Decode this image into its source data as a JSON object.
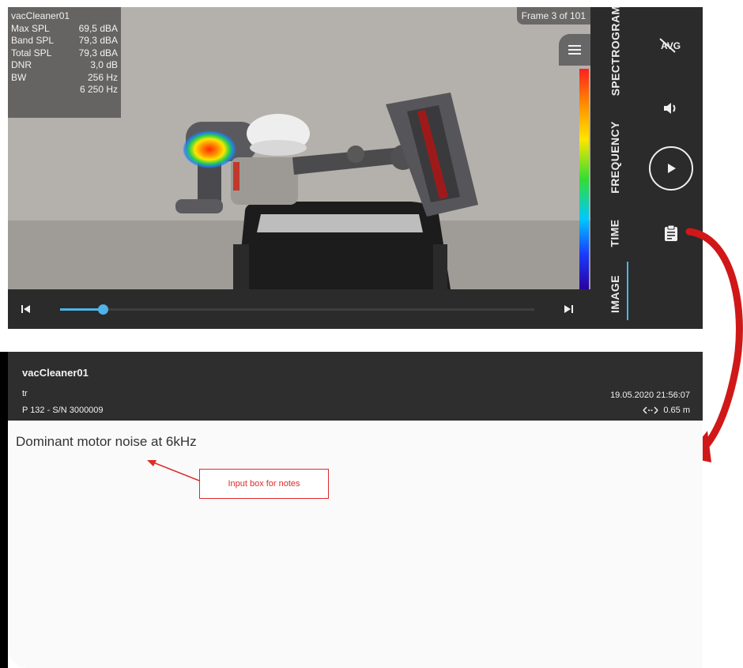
{
  "recording": {
    "name": "vacCleaner01",
    "frame_label": "Frame 3 of 101",
    "stats": [
      {
        "label": "Max SPL",
        "value": "69,5 dBA"
      },
      {
        "label": "Band SPL",
        "value": "79,3 dBA"
      },
      {
        "label": "Total SPL",
        "value": "79,3 dBA"
      },
      {
        "label": "DNR",
        "value": "3,0 dB"
      },
      {
        "label": "BW",
        "value": "256 Hz"
      },
      {
        "label": "",
        "value": "6 250 Hz"
      }
    ],
    "playback_progress": 0.09
  },
  "tabs": [
    {
      "label": "SPECTROGRAM"
    },
    {
      "label": "FREQUENCY"
    },
    {
      "label": "TIME"
    },
    {
      "label": "IMAGE",
      "active": true
    }
  ],
  "actions": {
    "avg_label": "AVG",
    "icons": [
      "avg-off-icon",
      "volume-icon",
      "play-icon",
      "clipboard-icon"
    ]
  },
  "details": {
    "title": "vacCleaner01",
    "user": "tr",
    "device": "P 132 - S/N 3000009",
    "datetime": "19.05.2020 21:56:07",
    "distance": "0.65 m",
    "notes": "Dominant motor noise at 6kHz"
  },
  "annotation": {
    "label": "Input box for notes"
  },
  "colors": {
    "accent": "#4fb3e8",
    "annotation_red": "#e02a2a",
    "dark_bg": "#2b2b2b"
  }
}
